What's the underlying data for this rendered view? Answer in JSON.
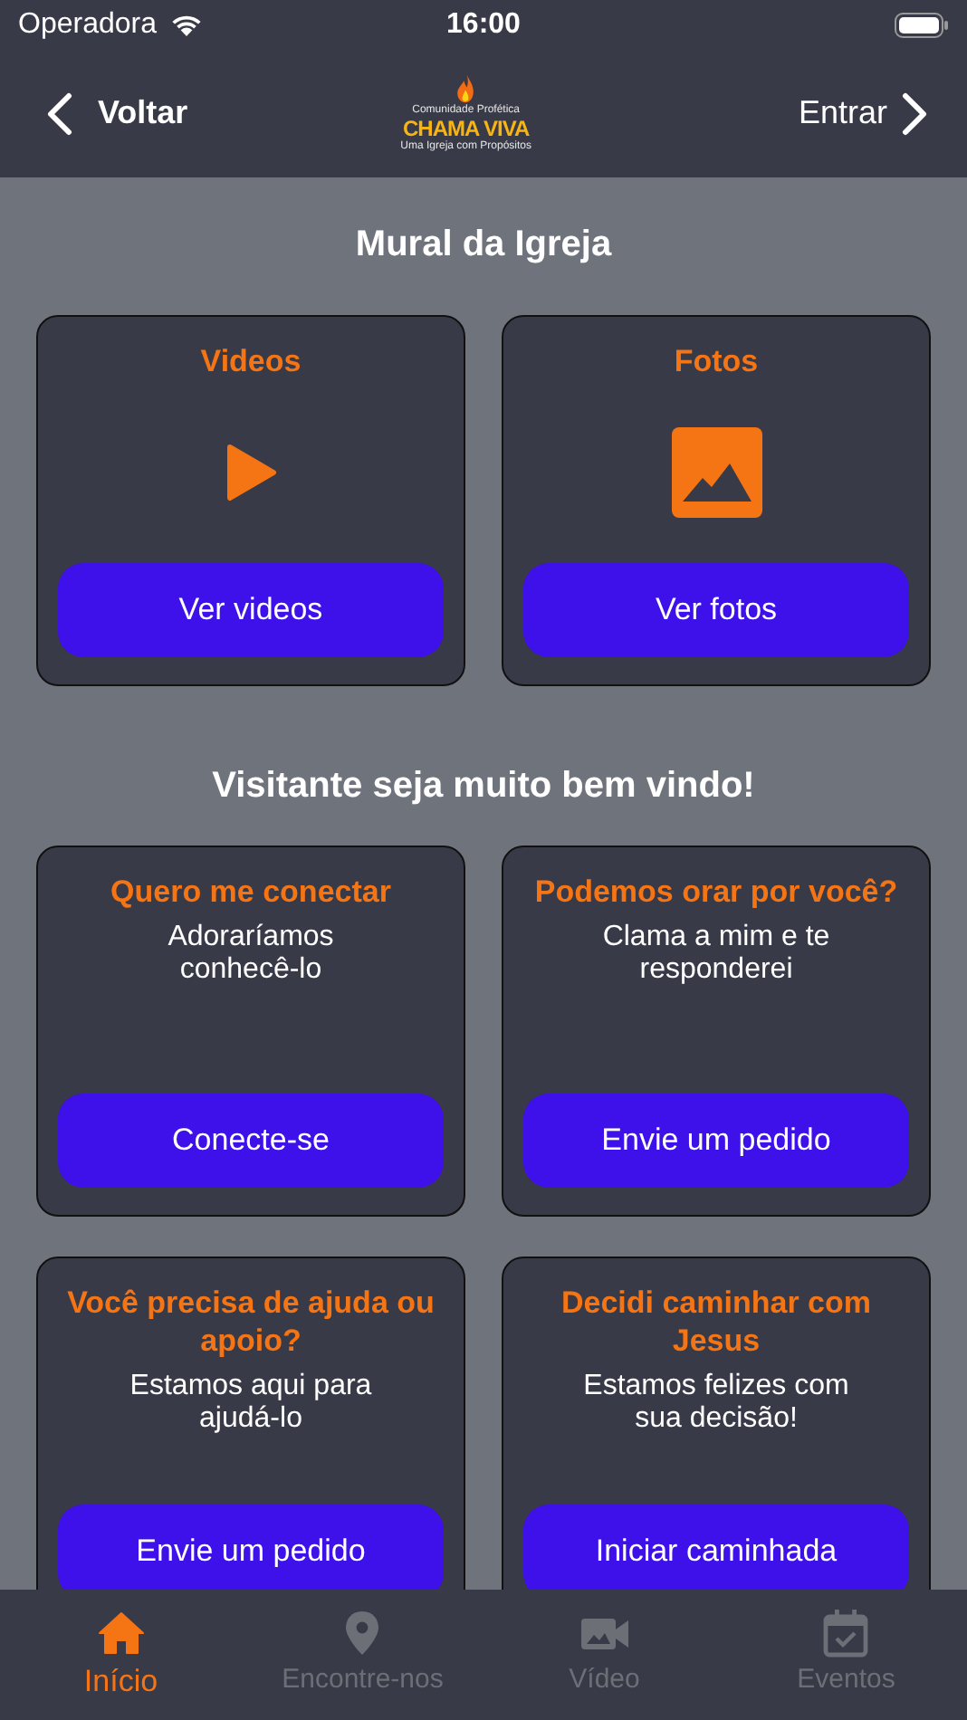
{
  "status_bar": {
    "carrier": "Operadora",
    "time": "16:00"
  },
  "nav": {
    "back": "Voltar",
    "forward": "Entrar",
    "logo": {
      "top": "Comunidade Profética",
      "name": "CHAMA VIVA",
      "tagline": "Uma Igreja com Propósitos"
    }
  },
  "mural": {
    "title": "Mural da Igreja",
    "cards": [
      {
        "title": "Videos",
        "kind": "video",
        "button": "Ver videos"
      },
      {
        "title": "Fotos",
        "kind": "photo",
        "button": "Ver fotos"
      }
    ]
  },
  "welcome": {
    "title": "Visitante seja muito bem vindo!",
    "cards": [
      {
        "title": "Quero me conectar",
        "text": "Adoraríamos conhecê-lo",
        "button": "Conecte-se"
      },
      {
        "title": "Podemos orar por você?",
        "text": "Clama a mim e te responderei",
        "button": "Envie um pedido"
      },
      {
        "title": "Você precisa de ajuda ou apoio?",
        "text": "Estamos aqui para ajudá-lo",
        "button": "Envie um pedido"
      },
      {
        "title": "Decidi caminhar com Jesus",
        "text": "Estamos felizes com sua decisão!",
        "button": "Iniciar caminhada"
      }
    ]
  },
  "tab_bar": [
    {
      "label": "Início",
      "kind": "home",
      "selected": true
    },
    {
      "label": "Encontre-nos",
      "kind": "pin",
      "selected": false
    },
    {
      "label": "Vídeo",
      "kind": "camera",
      "selected": false
    },
    {
      "label": "Eventos",
      "kind": "calendar",
      "selected": false
    }
  ]
}
